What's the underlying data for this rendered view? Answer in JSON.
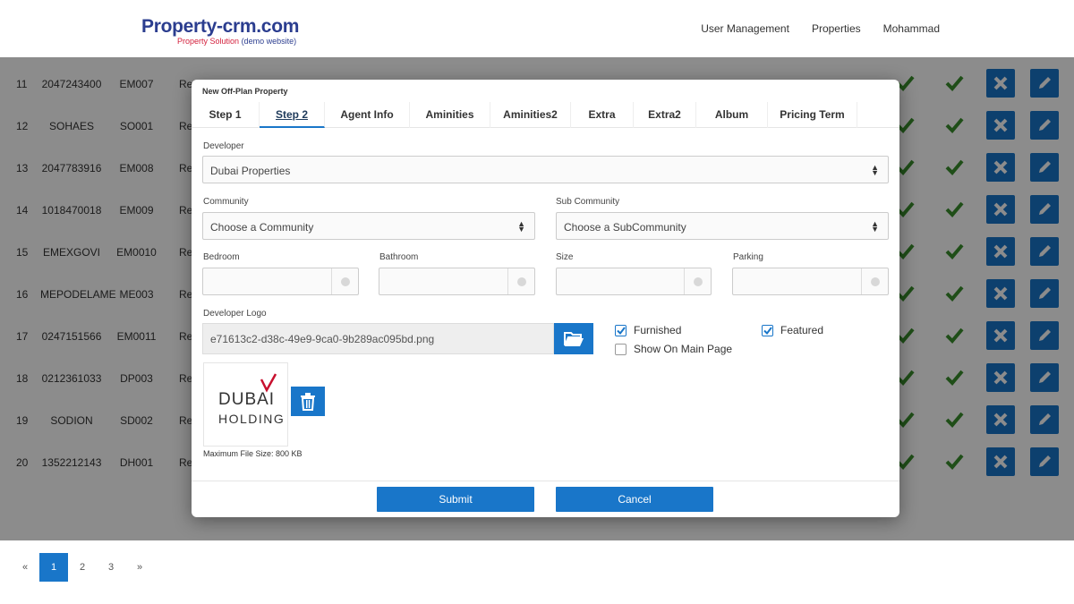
{
  "header": {
    "logo_main": "Property-crm.com",
    "logo_sub_1": "Property Solution",
    "logo_sub_2": "(demo website)",
    "nav": [
      "User Management",
      "Properties",
      "Mohammad"
    ]
  },
  "table": {
    "rows": [
      {
        "num": "11",
        "id": "2047243400",
        "code": "EM007",
        "text": "Re"
      },
      {
        "num": "12",
        "id": "SOHAES",
        "code": "SO001",
        "text": "Re"
      },
      {
        "num": "13",
        "id": "2047783916",
        "code": "EM008",
        "text": "Re"
      },
      {
        "num": "14",
        "id": "1018470018",
        "code": "EM009",
        "text": "Re"
      },
      {
        "num": "15",
        "id": "EMEXGOVI",
        "code": "EM0010",
        "text": "Re"
      },
      {
        "num": "16",
        "id": "MEPODELAME",
        "code": "ME003",
        "text": "Re"
      },
      {
        "num": "17",
        "id": "0247151566",
        "code": "EM0011",
        "text": "Re"
      },
      {
        "num": "18",
        "id": "0212361033",
        "code": "DP003",
        "text": "Re"
      },
      {
        "num": "19",
        "id": "SODION",
        "code": "SD002",
        "text": "Re"
      },
      {
        "num": "20",
        "id": "1352212143",
        "code": "DH001",
        "text": "Re"
      }
    ],
    "pager": [
      "«",
      "1",
      "2",
      "3",
      "»"
    ]
  },
  "modal": {
    "title": "New Off-Plan Property",
    "tabs": [
      "Step 1",
      "Step 2",
      "Agent Info",
      "Aminities",
      "Aminities2",
      "Extra",
      "Extra2",
      "Album",
      "Pricing Term"
    ],
    "developer_label": "Developer",
    "developer_value": "Dubai Properties",
    "community_label": "Community",
    "community_value": "Choose a Community",
    "subcommunity_label": "Sub Community",
    "subcommunity_value": "Choose a SubCommunity",
    "bedroom_label": "Bedroom",
    "bathroom_label": "Bathroom",
    "size_label": "Size",
    "parking_label": "Parking",
    "logo_label": "Developer Logo",
    "logo_file": "e71613c2-d38c-49e9-9ca0-9b289ac095bd.png",
    "furnished_label": "Furnished",
    "featured_label": "Featured",
    "main_page_label": "Show On Main Page",
    "preview_line1": "DUBAI",
    "preview_line2": "HOLDING",
    "max_size": "Maximum File Size: 800 KB",
    "submit": "Submit",
    "cancel": "Cancel"
  },
  "colors": {
    "accent": "#1976c9",
    "brand": "#2b3d8f",
    "brand_red": "#d4213d",
    "check": "#3a8f2c"
  }
}
